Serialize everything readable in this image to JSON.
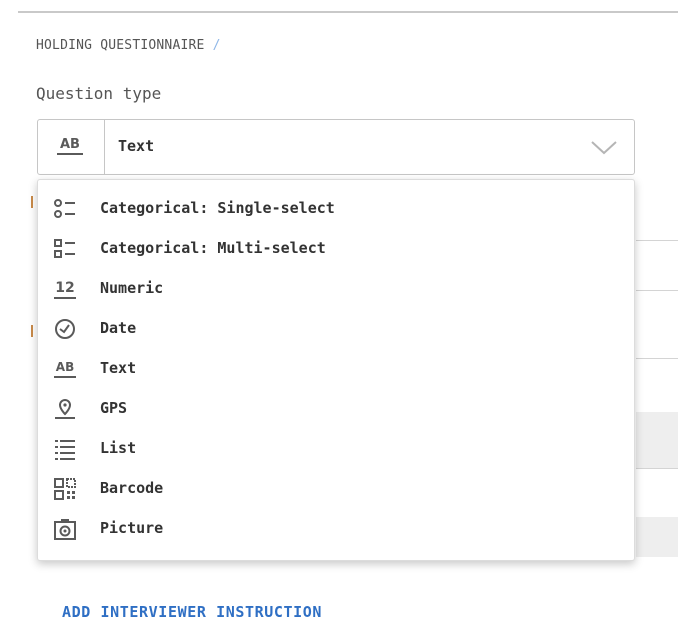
{
  "breadcrumb": {
    "section": "HOLDING QUESTIONNAIRE",
    "separator": "/"
  },
  "question_type": {
    "label": "Question type",
    "selected": {
      "icon": "text-ab-icon",
      "label": "Text"
    }
  },
  "dropdown": {
    "items": [
      {
        "icon": "single-select-icon",
        "label": "Categorical: Single-select"
      },
      {
        "icon": "multi-select-icon",
        "label": "Categorical: Multi-select"
      },
      {
        "icon": "numeric-12-icon",
        "label": "Numeric"
      },
      {
        "icon": "clock-icon",
        "label": "Date"
      },
      {
        "icon": "text-ab-icon",
        "label": "Text"
      },
      {
        "icon": "location-pin-icon",
        "label": "GPS"
      },
      {
        "icon": "list-icon",
        "label": "List"
      },
      {
        "icon": "barcode-icon",
        "label": "Barcode"
      },
      {
        "icon": "camera-icon",
        "label": "Picture"
      }
    ]
  },
  "actions": {
    "add_instruction": "ADD INTERVIEWER INSTRUCTION"
  },
  "colors": {
    "link": "#2f6fc4",
    "separator": "#8fb7e8",
    "icon": "#5a5a5a"
  }
}
